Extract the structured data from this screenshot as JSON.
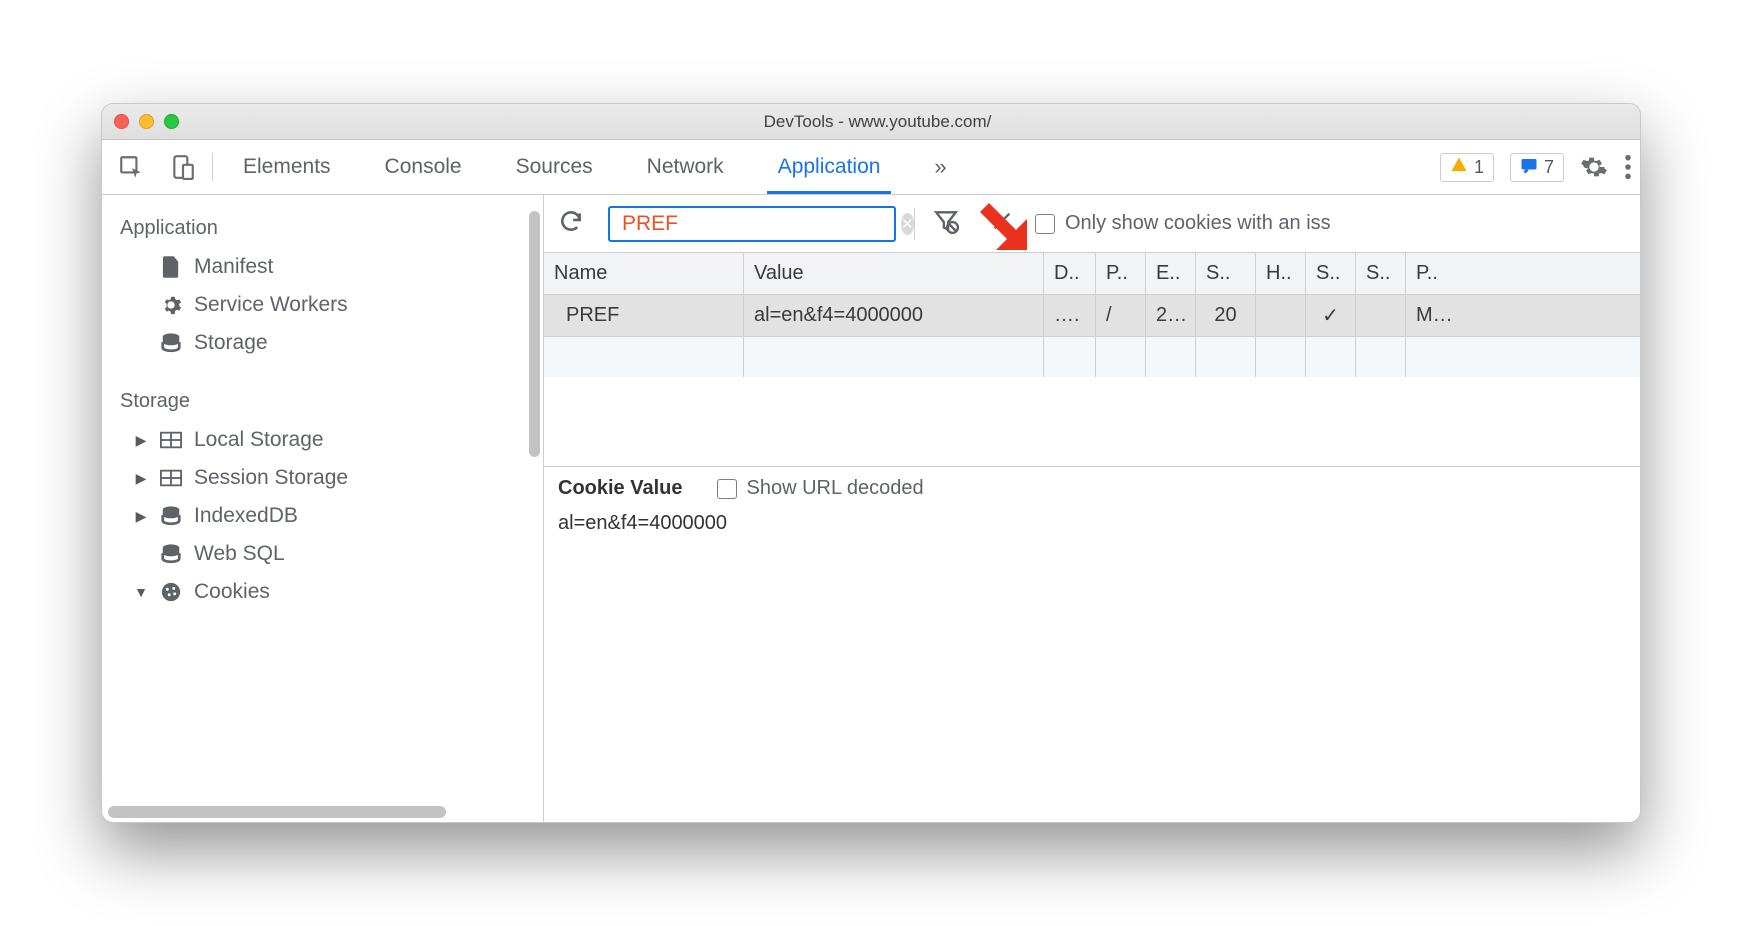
{
  "window": {
    "title": "DevTools - www.youtube.com/"
  },
  "tabs": {
    "elements": "Elements",
    "console": "Console",
    "sources": "Sources",
    "network": "Network",
    "application": "Application"
  },
  "badges": {
    "warnings": "1",
    "messages": "7"
  },
  "sidebar": {
    "application_header": "Application",
    "manifest": "Manifest",
    "service_workers": "Service Workers",
    "storage_main": "Storage",
    "storage_header": "Storage",
    "local_storage": "Local Storage",
    "session_storage": "Session Storage",
    "indexeddb": "IndexedDB",
    "web_sql": "Web SQL",
    "cookies": "Cookies"
  },
  "filter": {
    "value": "PREF",
    "only_issues_label": "Only show cookies with an iss"
  },
  "columns": {
    "name": "Name",
    "value": "Value",
    "d": "D..",
    "p": "P..",
    "e": "E..",
    "s": "S..",
    "h": "H..",
    "se": "S..",
    "sa": "S..",
    "pr": "P.."
  },
  "row": {
    "name": "PREF",
    "value": "al=en&f4=4000000",
    "d": "….",
    "p": "/",
    "e": "2…",
    "s": "20",
    "h": "",
    "se": "✓",
    "sa": "",
    "pr": "M…"
  },
  "detail": {
    "header": "Cookie Value",
    "decoded_label": "Show URL decoded",
    "value": "al=en&f4=4000000"
  }
}
